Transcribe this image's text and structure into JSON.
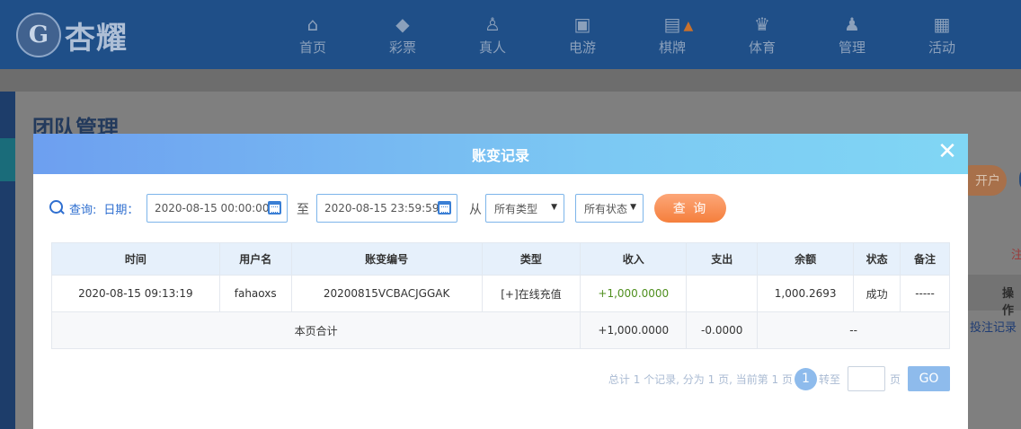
{
  "logo": {
    "badge": "G",
    "text": "杏耀"
  },
  "nav": [
    {
      "icon": "home-icon",
      "glyph": "⌂",
      "label": "首页"
    },
    {
      "icon": "lottery-icon",
      "glyph": "◆",
      "label": "彩票"
    },
    {
      "icon": "live-icon",
      "glyph": "♙",
      "label": "真人"
    },
    {
      "icon": "slot-icon",
      "glyph": "▣",
      "label": "电游"
    },
    {
      "icon": "mahjong-icon",
      "glyph": "▤",
      "label": "棋牌"
    },
    {
      "icon": "trophy-icon",
      "glyph": "♛",
      "label": "体育"
    },
    {
      "icon": "users-icon",
      "glyph": "♟",
      "label": "管理"
    },
    {
      "icon": "gift-icon",
      "glyph": "▦",
      "label": "活动"
    }
  ],
  "page": {
    "title": "团队管理",
    "open_button": "开户",
    "note": "注",
    "op_header": "操作",
    "link": "投注记录"
  },
  "modal": {
    "title": "账变记录",
    "close": "✕",
    "filter": {
      "query_label": "查询:",
      "date_label": "日期：",
      "start": "2020-08-15 00:00:00",
      "to": "至",
      "end": "2020-08-15 23:59:59",
      "from": "从",
      "type_select": "所有类型",
      "status_select": "所有状态",
      "submit": "查 询"
    },
    "table": {
      "headers": [
        "时间",
        "用户名",
        "账变编号",
        "类型",
        "收入",
        "支出",
        "余额",
        "状态",
        "备注"
      ],
      "row": {
        "time": "2020-08-15 09:13:19",
        "user": "fahaoxs",
        "id": "20200815VCBACJGGAK",
        "type": "[+]在线充值",
        "income": "+1,000.0000",
        "expense": "",
        "balance": "1,000.2693",
        "status": "成功",
        "remark": "-----"
      },
      "total": {
        "label": "本页合计",
        "income": "+1,000.0000",
        "expense": "-0.0000",
        "rest": "--"
      }
    },
    "pager": {
      "summary": "总计 1 个记录, 分为 1 页, 当前第 1 页",
      "current": "1",
      "jump": "转至",
      "unit": "页",
      "go": "GO"
    }
  },
  "colors": {
    "nav_bg": "#1f4f88",
    "modal_header": "#7cc8f3",
    "accent_blue": "#2f6fd0",
    "query_orange": "#f57f3c",
    "income_green": "#4f8f1e"
  }
}
